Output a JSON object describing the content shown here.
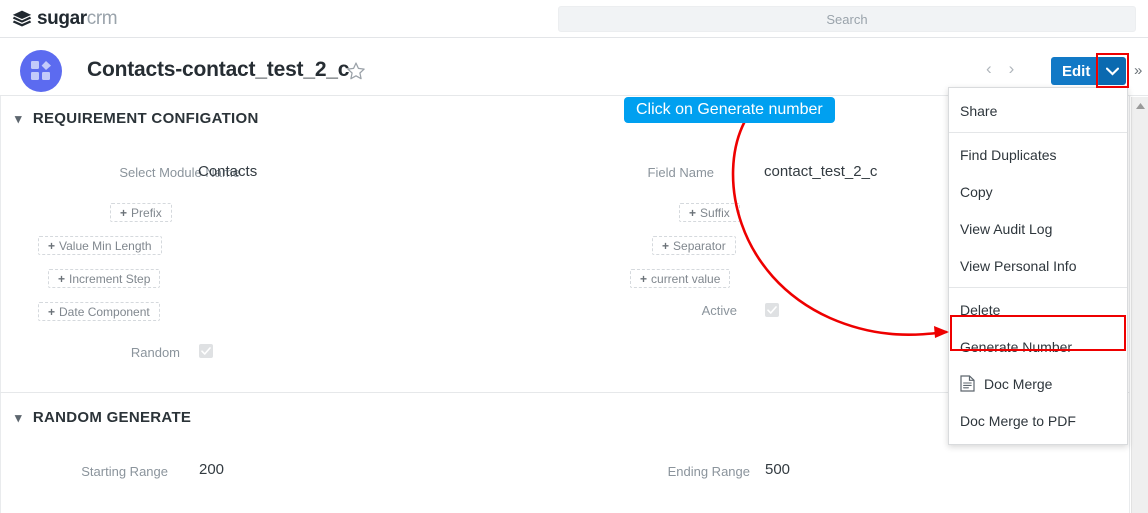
{
  "topbar": {
    "brand_primary": "sugar",
    "brand_secondary": "crm",
    "search_placeholder": "Search"
  },
  "record_header": {
    "title": "Contacts-contact_test_2_c",
    "favorite_icon": "star-icon",
    "prev_label": "‹",
    "next_label": "›",
    "edit_label": "Edit",
    "caret_icon": "chevron-down-icon",
    "more_icon": "double-chevron-right-icon"
  },
  "sections": [
    {
      "id": "requirement",
      "title": "REQUIREMENT CONFIGATION",
      "left_fields": [
        {
          "label": "Select Module Name",
          "value": "Contacts"
        }
      ],
      "left_buttons": [
        {
          "label": "Prefix"
        },
        {
          "label": "Value Min Length"
        },
        {
          "label": "Increment Step"
        },
        {
          "label": "Date Component"
        }
      ],
      "left_checkbox": {
        "label": "Random",
        "checked": true
      },
      "right_fields": [
        {
          "label": "Field Name",
          "value": "contact_test_2_c"
        }
      ],
      "right_buttons": [
        {
          "label": "Suffix"
        },
        {
          "label": "Separator"
        },
        {
          "label": "current value"
        }
      ],
      "right_checkbox": {
        "label": "Active",
        "checked": true
      }
    },
    {
      "id": "random-generate",
      "title": "RANDOM GENERATE",
      "fields": [
        {
          "label": "Starting Range",
          "value": "200"
        },
        {
          "label": "Ending Range",
          "value": "500"
        }
      ]
    }
  ],
  "dropdown": {
    "items": [
      {
        "label": "Share",
        "icon": null,
        "separator_after": true
      },
      {
        "label": "Find Duplicates",
        "icon": null,
        "separator_after": false
      },
      {
        "label": "Copy",
        "icon": null,
        "separator_after": false
      },
      {
        "label": "View Audit Log",
        "icon": null,
        "separator_after": false
      },
      {
        "label": "View Personal Info",
        "icon": null,
        "separator_after": true
      },
      {
        "label": "Delete",
        "icon": null,
        "separator_after": false
      },
      {
        "label": "Generate Number",
        "icon": null,
        "separator_after": false
      },
      {
        "label": "Doc Merge",
        "icon": "document-icon",
        "separator_after": false
      },
      {
        "label": "Doc Merge to PDF",
        "icon": null,
        "separator_after": false
      }
    ],
    "highlighted_item": "Generate Number"
  },
  "annotation": {
    "callout_text": "Click on Generate number",
    "callout_color": "#00a0f0",
    "arrow_color": "#ee0000",
    "highlight_color": "#ee0000"
  },
  "colors": {
    "edit_button": "#1279c6",
    "module_icon": "#5c6bf0",
    "label_gray": "#8b949c",
    "value_dark": "#333b41"
  }
}
